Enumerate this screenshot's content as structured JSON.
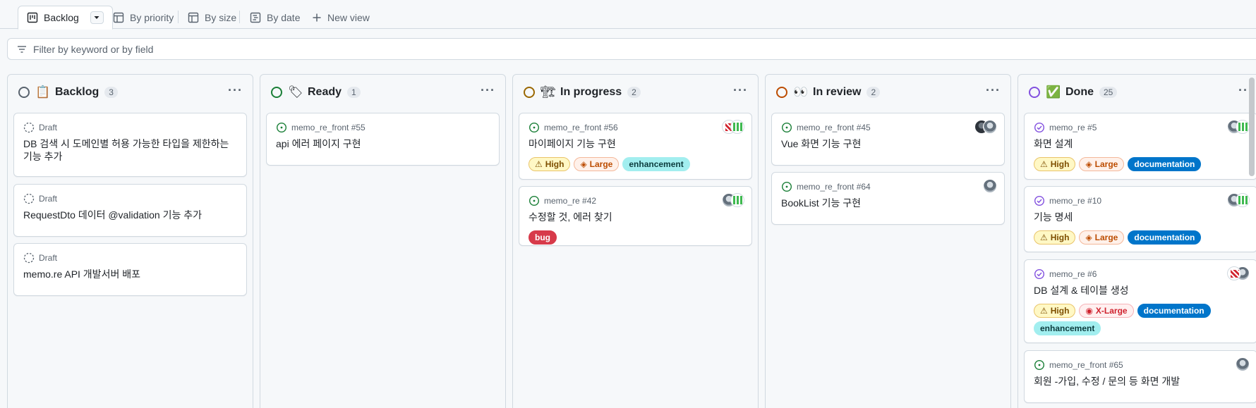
{
  "tabs": {
    "backlog": "Backlog",
    "by_priority": "By priority",
    "by_size": "By size",
    "by_date": "By date",
    "new_view": "New view"
  },
  "filter": {
    "placeholder": "Filter by keyword or by field"
  },
  "colors": {
    "gray": "#59636e",
    "green": "#1a7f37",
    "yellow": "#9a6700",
    "orange": "#bc4c00",
    "purple": "#8250df"
  },
  "columns": [
    {
      "title": "Backlog",
      "count": "3",
      "emoji": "📋",
      "cards": [
        {
          "meta": "Draft",
          "title": "DB 검색 시 도메인별 허용 가능한 타입을 제한하는 기능 추가"
        },
        {
          "meta": "Draft",
          "title": "RequestDto 데이터 @validation 기능 추가"
        },
        {
          "meta": "Draft",
          "title": "memo.re API 개발서버 배포"
        }
      ]
    },
    {
      "title": "Ready",
      "count": "1",
      "emoji": "🏷",
      "cards": [
        {
          "meta": "memo_re_front #55",
          "title": "api 에러 페이지 구현"
        }
      ]
    },
    {
      "title": "In progress",
      "count": "2",
      "emoji": "🏗",
      "cards": [
        {
          "meta": "memo_re_front #56",
          "title": "마이페이지 기능 구현",
          "labels": [
            "High",
            "Large",
            "enhancement"
          ]
        },
        {
          "meta": "memo_re #42",
          "title": "수정할 것, 에러 찾기",
          "labels": [
            "bug"
          ]
        }
      ]
    },
    {
      "title": "In review",
      "count": "2",
      "emoji": "👀",
      "cards": [
        {
          "meta": "memo_re_front #45",
          "title": "Vue 화면 기능 구현"
        },
        {
          "meta": "memo_re_front #64",
          "title": "BookList 기능 구현"
        }
      ]
    },
    {
      "title": "Done",
      "count": "25",
      "emoji": "✅",
      "cards": [
        {
          "meta": "memo_re #5",
          "title": "화면 설계",
          "labels": [
            "High",
            "Large",
            "documentation"
          ]
        },
        {
          "meta": "memo_re #10",
          "title": "기능 명세",
          "labels": [
            "High",
            "Large",
            "documentation"
          ]
        },
        {
          "meta": "memo_re #6",
          "title": "DB 설계 & 테이블 생성",
          "labels": [
            "High",
            "X-Large",
            "documentation",
            "enhancement"
          ]
        },
        {
          "meta": "memo_re_front #65",
          "title": "회원 -가입, 수정 / 문의 등 화면 개발"
        }
      ]
    }
  ]
}
